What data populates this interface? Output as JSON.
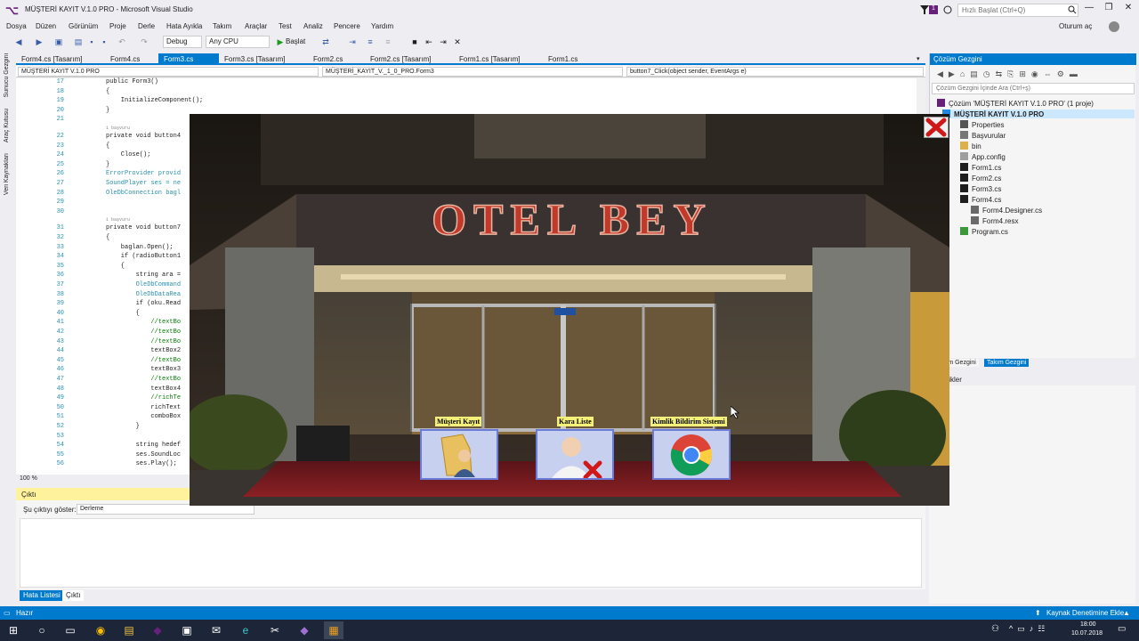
{
  "window": {
    "title": "MÜŞTERİ KAYIT V.1.0 PRO - Microsoft Visual Studio",
    "quick_launch_placeholder": "Hızlı Başlat (Ctrl+Q)",
    "signin": "Oturum aç"
  },
  "menu": [
    "Dosya",
    "Düzen",
    "Görünüm",
    "Proje",
    "Derle",
    "Hata Ayıkla",
    "Takım",
    "Araçlar",
    "Test",
    "Analiz",
    "Pencere",
    "Yardım"
  ],
  "toolbar": {
    "config": "Debug",
    "platform": "Any CPU",
    "start": "Başlat"
  },
  "left_tabs": [
    "Sunucu Gezgini",
    "Araç Kutusu",
    "Veri Kaynakları"
  ],
  "doc_tabs": [
    "Form4.cs [Tasarım]",
    "Form4.cs",
    "Form3.cs",
    "Form3.cs [Tasarım]",
    "Form2.cs",
    "Form2.cs [Tasarım]",
    "Form1.cs [Tasarım]",
    "Form1.cs"
  ],
  "nav": {
    "project": "MÜŞTERİ KAYIT V.1.0 PRO",
    "class": "MÜŞTERİ_KAYIT_V._1_0_PRO.Form3",
    "member": "button7_Click(object sender, EventArgs e)"
  },
  "code_lines": [
    {
      "n": "17",
      "t": "public Form3()"
    },
    {
      "n": "18",
      "t": "{"
    },
    {
      "n": "19",
      "t": "    InitializeComponent();"
    },
    {
      "n": "20",
      "t": "}"
    },
    {
      "n": "21",
      "t": ""
    },
    {
      "n": "22",
      "t": "private void button4"
    },
    {
      "n": "23",
      "t": "{"
    },
    {
      "n": "24",
      "t": "    Close();"
    },
    {
      "n": "25",
      "t": "}"
    },
    {
      "n": "26",
      "t": "ErrorProvider provid"
    },
    {
      "n": "27",
      "t": "SoundPlayer ses = ne"
    },
    {
      "n": "28",
      "t": "OleDbConnection bagl"
    },
    {
      "n": "29",
      "t": ""
    },
    {
      "n": "30",
      "t": ""
    },
    {
      "n": "31",
      "t": "private void button7"
    },
    {
      "n": "32",
      "t": "{"
    },
    {
      "n": "33",
      "t": "    baglan.Open();"
    },
    {
      "n": "34",
      "t": "    if (radioButton1"
    },
    {
      "n": "35",
      "t": "    {"
    },
    {
      "n": "36",
      "t": "        string ara ="
    },
    {
      "n": "37",
      "t": "        OleDbCommand"
    },
    {
      "n": "38",
      "t": "        OleDbDataRea"
    },
    {
      "n": "39",
      "t": "        if (oku.Read"
    },
    {
      "n": "40",
      "t": "        {"
    },
    {
      "n": "41",
      "t": "            //textBo"
    },
    {
      "n": "42",
      "t": "            //textBo"
    },
    {
      "n": "43",
      "t": "            //textBo"
    },
    {
      "n": "44",
      "t": "            textBox2"
    },
    {
      "n": "45",
      "t": "            //textBo"
    },
    {
      "n": "46",
      "t": "            textBox3"
    },
    {
      "n": "47",
      "t": "            //textBo"
    },
    {
      "n": "48",
      "t": "            textBox4"
    },
    {
      "n": "49",
      "t": "            //richTe"
    },
    {
      "n": "50",
      "t": "            richText"
    },
    {
      "n": "51",
      "t": "            comboBox"
    },
    {
      "n": "52",
      "t": "        }"
    },
    {
      "n": "53",
      "t": ""
    },
    {
      "n": "54",
      "t": "        string hedef"
    },
    {
      "n": "55",
      "t": "        ses.SoundLoc"
    },
    {
      "n": "56",
      "t": "        ses.Play();"
    }
  ],
  "refs": {
    "a": "1 başvuru",
    "b": "1 başvuru"
  },
  "zoom": "100 %",
  "output": {
    "title": "Çıktı",
    "show_label": "Şu çıktıyı göster:",
    "show_value": "Derleme"
  },
  "bottom_tabs": [
    "Hata Listesi",
    "Çıktı"
  ],
  "solution": {
    "title": "Çözüm Gezgini",
    "search_placeholder": "Çözüm Gezgini İçinde Ara (Ctrl+ş)",
    "items": [
      "Çözüm 'MÜŞTERİ KAYIT V.1.0 PRO' (1 proje)",
      "MÜŞTERİ KAYIT V.1.0 PRO",
      "Properties",
      "Başvurular",
      "bin",
      "App.config",
      "Form1.cs",
      "Form2.cs",
      "Form3.cs",
      "Form4.cs",
      "Form4.Designer.cs",
      "Form4.resx",
      "Program.cs"
    ],
    "tabs": [
      "Çözüm Gezgini",
      "Takım Gezgini"
    ]
  },
  "props_title": "Özellikler",
  "form3": {
    "sign": "OTEL BEY",
    "buttons": [
      {
        "label": "Müşteri Kayıt",
        "icon": "customer-folder-icon"
      },
      {
        "label": "Kara Liste",
        "icon": "blacklist-user-icon"
      },
      {
        "label": "Kimlik Bildirim Sistemi",
        "icon": "chrome-icon"
      }
    ]
  },
  "status": {
    "ready": "Hazır",
    "source_control": "Kaynak Denetimine Ekle"
  },
  "clock": {
    "time": "18:00",
    "date": "10.07.2018"
  },
  "colors": {
    "vs_blue": "#007acc",
    "vs_purple": "#68217a",
    "label_yellow": "#f5f07a"
  }
}
